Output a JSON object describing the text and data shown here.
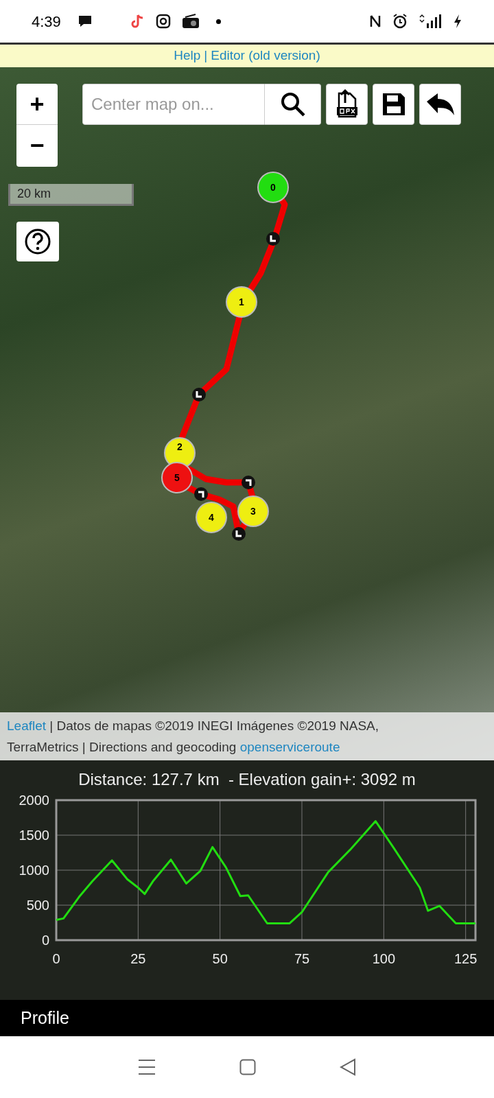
{
  "status_bar": {
    "time": "4:39"
  },
  "top_links": {
    "links": [
      "Help",
      "Editor (old version)"
    ],
    "separator": "|"
  },
  "map": {
    "zoom_in": "+",
    "zoom_out": "−",
    "search": {
      "placeholder": "Center map on..."
    },
    "scale": "20 km",
    "markers": [
      {
        "label": "0",
        "color": "#22dd11"
      },
      {
        "label": "1",
        "color": "#eeee11"
      },
      {
        "label": "2",
        "color": "#eeee11"
      },
      {
        "label": "5",
        "color": "#ee1111"
      },
      {
        "label": "3",
        "color": "#eeee11"
      },
      {
        "label": "4",
        "color": "#eeee11"
      }
    ],
    "attribution": {
      "link_1": "Leaflet",
      "text": " | Datos de mapas ©2019 INEGI Imágenes ©2019 NASA, TerraMetrics | Directions and geocoding ",
      "link_2": "openserviceroute"
    }
  },
  "profile": {
    "summary": "Distance: 127.7 km  - Elevation gain+: 3092 m",
    "chart_data": {
      "type": "line",
      "grid": true,
      "xlim": [
        0,
        128
      ],
      "ylim": [
        0,
        2000
      ],
      "xticks": [
        0,
        25,
        50,
        75,
        100,
        125
      ],
      "yticks": [
        0,
        500,
        1000,
        1500,
        2000
      ],
      "x": [
        0,
        2.2,
        7,
        11,
        17,
        21.7,
        25,
        27,
        29.5,
        35,
        39.7,
        44,
        47.7,
        51.8,
        56.2,
        58.6,
        64.4,
        71.2,
        75,
        83,
        89.7,
        97.5,
        103,
        111,
        113.5,
        117,
        122,
        128
      ],
      "series": [
        {
          "color": "#22dd11",
          "values": [
            290,
            310,
            620,
            840,
            1140,
            870,
            750,
            660,
            840,
            1150,
            810,
            990,
            1330,
            1040,
            630,
            640,
            240,
            240,
            400,
            970,
            1290,
            1700,
            1320,
            750,
            420,
            490,
            240,
            240
          ]
        }
      ]
    },
    "tab": "Profile"
  }
}
